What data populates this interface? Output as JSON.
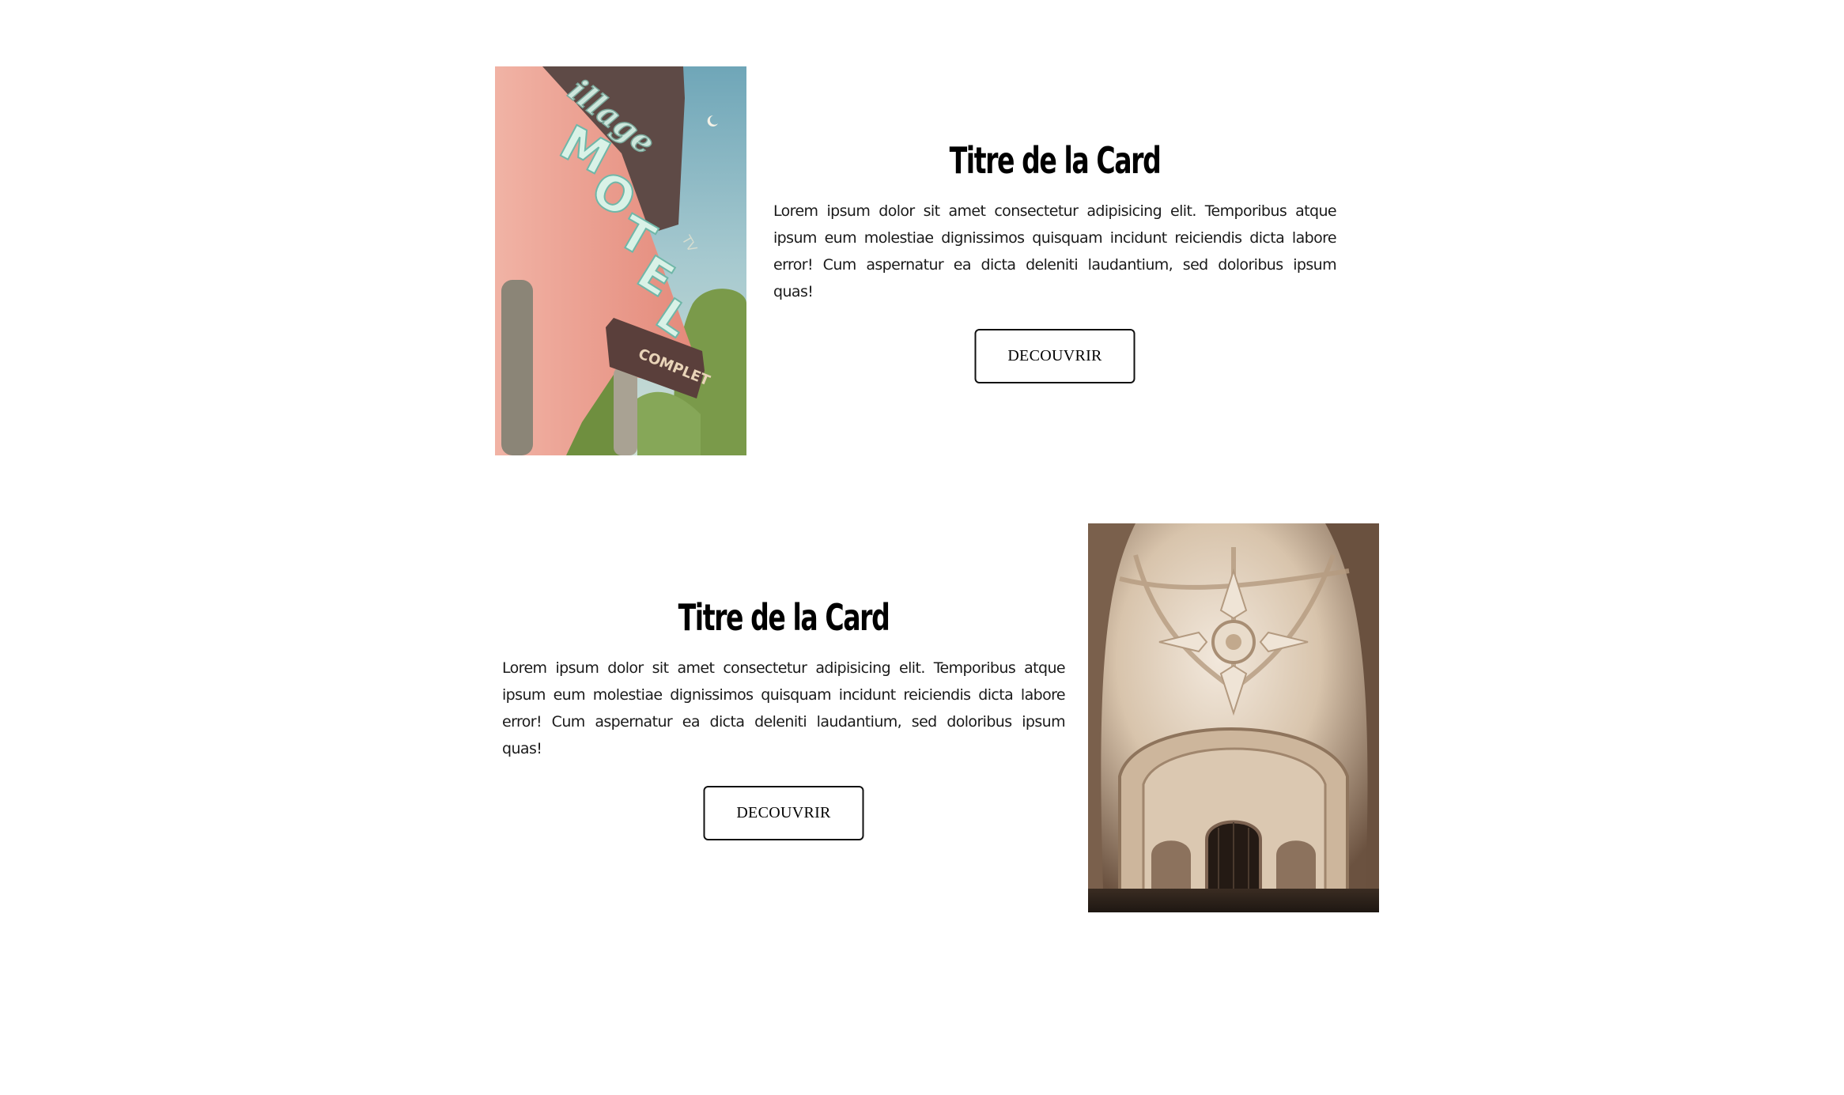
{
  "cards": [
    {
      "title": "Titre de la Card",
      "text": "Lorem ipsum dolor sit amet consectetur adipisicing elit. Temporibus atque ipsum eum molestiae dignissimos quisquam incidunt reiciendis dicta labore error! Cum aspernatur ea dicta deleniti laudantium, sed doloribus ipsum quas!",
      "button_label": "DECOUVRIR",
      "image": {
        "subject": "retro motel neon sign",
        "sign_words": [
          "Village",
          "MOTEL",
          "TV",
          "COMPLET"
        ],
        "colors": [
          "#7fb1c2",
          "#e7a08f",
          "#5f4a45",
          "#7a9a52"
        ]
      }
    },
    {
      "title": "Titre de la Card",
      "text": "Lorem ipsum dolor sit amet consectetur adipisicing elit. Temporibus atque ipsum eum molestiae dignissimos quisquam incidunt reiciendis dicta labore error! Cum aspernatur ea dicta deleniti laudantium, sed doloribus ipsum quas!",
      "button_label": "DECOUVRIR",
      "image": {
        "subject": "carved stone vaulted ceiling",
        "colors": [
          "#e9dccb",
          "#b79c80",
          "#5a4434",
          "#2a1f18"
        ]
      }
    }
  ]
}
